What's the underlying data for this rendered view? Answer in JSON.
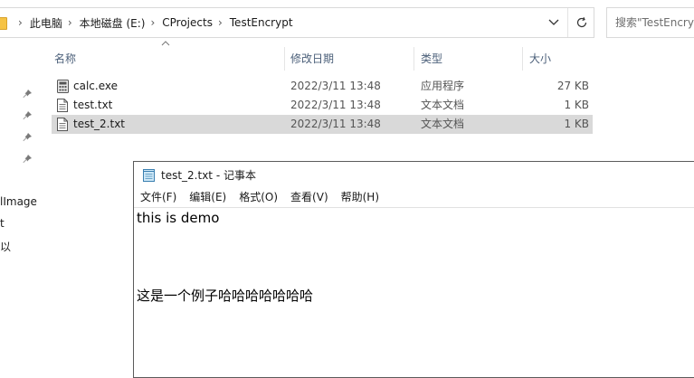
{
  "explorer": {
    "breadcrumbs": [
      "此电脑",
      "本地磁盘 (E:)",
      "CProjects",
      "TestEncrypt"
    ],
    "search_placeholder": "搜索\"TestEncrypt\"",
    "columns": {
      "name": "名称",
      "date": "修改日期",
      "type": "类型",
      "size": "大小"
    },
    "files": [
      {
        "name": "calc.exe",
        "date": "2022/3/11 13:48",
        "type": "应用程序",
        "size": "27 KB",
        "icon": "exe-icon",
        "selected": false
      },
      {
        "name": "test.txt",
        "date": "2022/3/11 13:48",
        "type": "文本文档",
        "size": "1 KB",
        "icon": "text-file-icon",
        "selected": false
      },
      {
        "name": "test_2.txt",
        "date": "2022/3/11 13:48",
        "type": "文本文档",
        "size": "1 KB",
        "icon": "text-file-icon",
        "selected": true
      }
    ],
    "nav_fragments": [
      "lImage",
      "t",
      "以"
    ]
  },
  "notepad": {
    "title": "test_2.txt - 记事本",
    "menu": [
      "文件(F)",
      "编辑(E)",
      "格式(O)",
      "查看(V)",
      "帮助(H)"
    ],
    "content_lines": [
      "this is demo",
      "",
      "",
      "这是一个例子哈哈哈哈哈哈哈"
    ]
  },
  "colors": {
    "selection": "#d9d9d9",
    "header_text": "#4c607a",
    "folder": "#f6c344"
  }
}
